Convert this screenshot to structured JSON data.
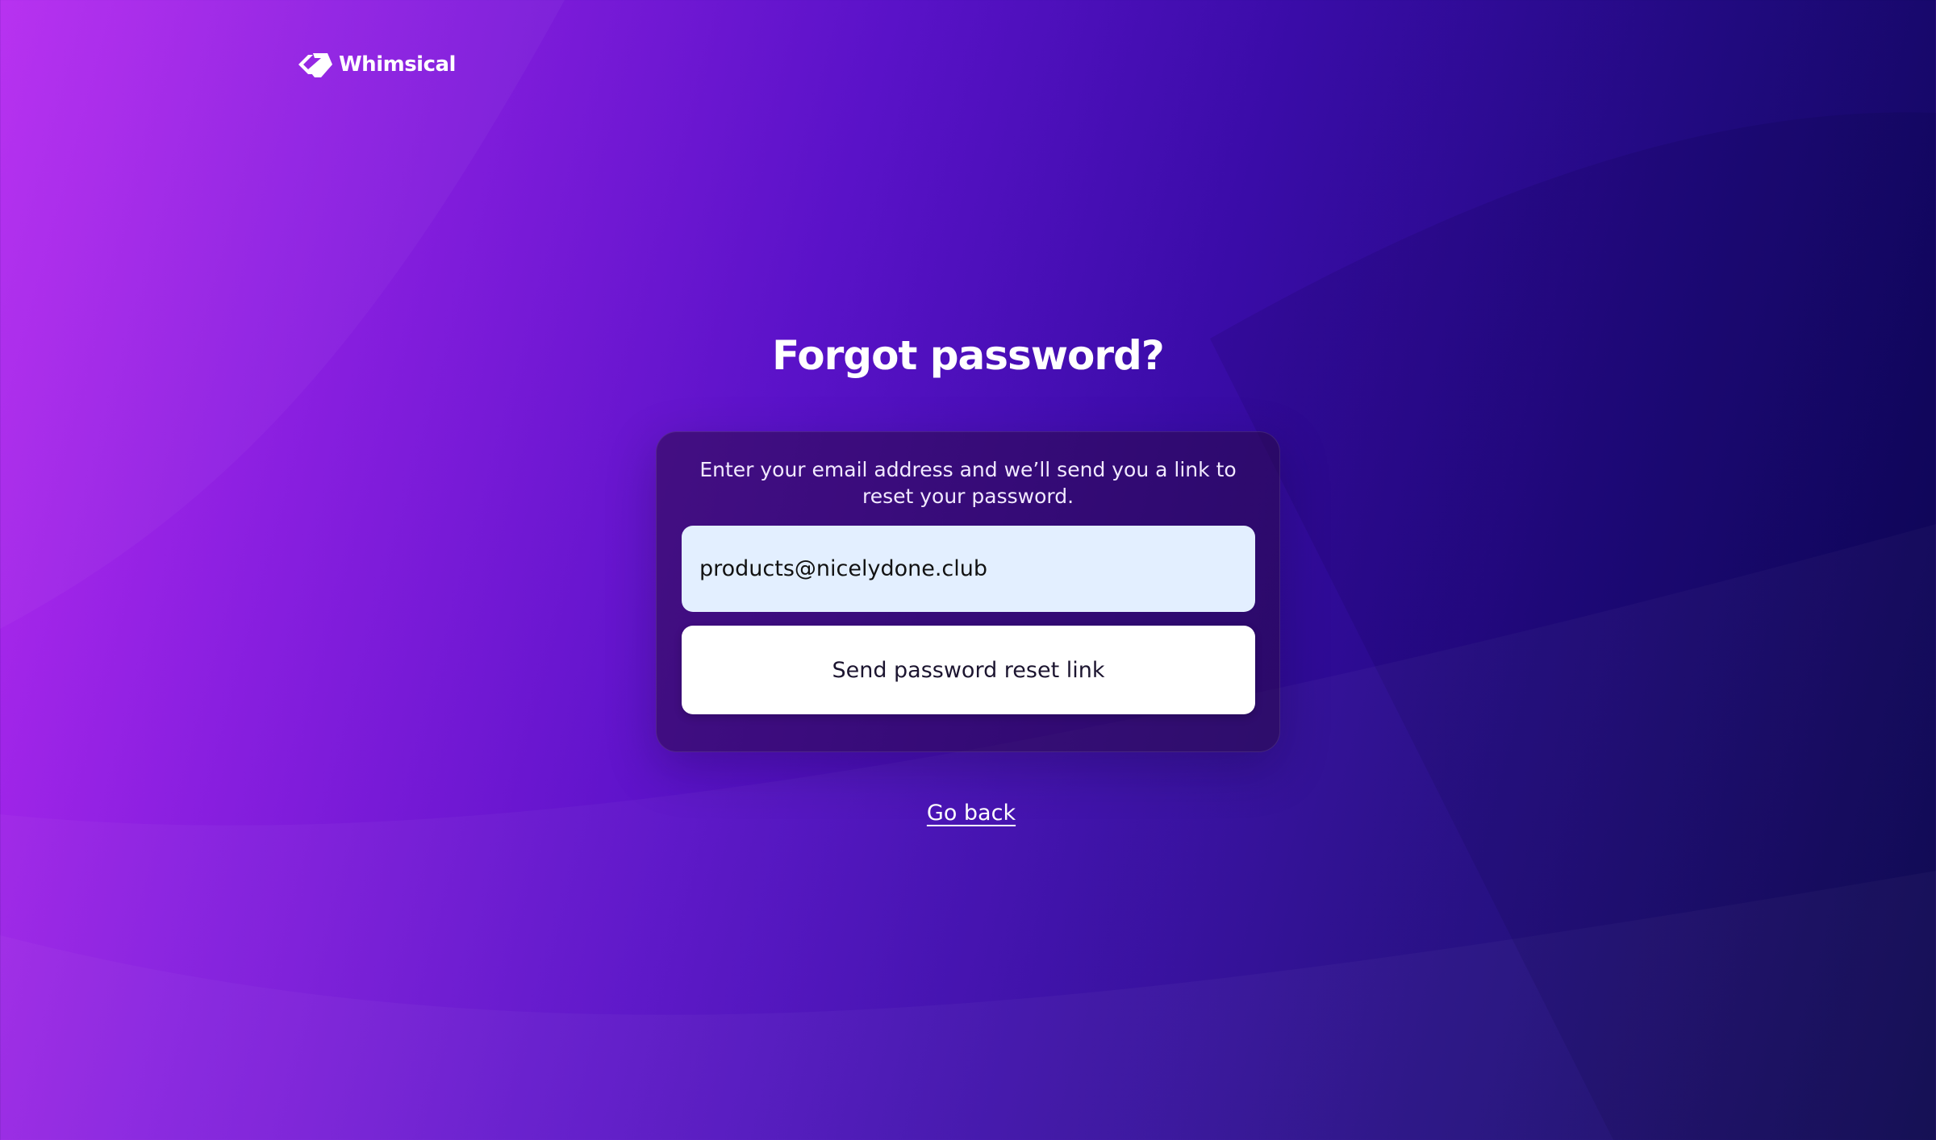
{
  "brand": {
    "name": "Whimsical",
    "logo_icon": "whimsical-diamond-icon"
  },
  "page": {
    "title": "Forgot password?"
  },
  "form": {
    "description": "Enter your email address and we’ll send you a link to reset your password.",
    "email_value": "products@nicelydone.club",
    "submit_label": "Send password reset link"
  },
  "links": {
    "go_back": "Go back"
  },
  "colors": {
    "background_start": "#b62bf0",
    "background_end": "#0a0550",
    "input_bg": "#e3efff",
    "button_bg": "#ffffff",
    "text_light": "#ffffff"
  }
}
